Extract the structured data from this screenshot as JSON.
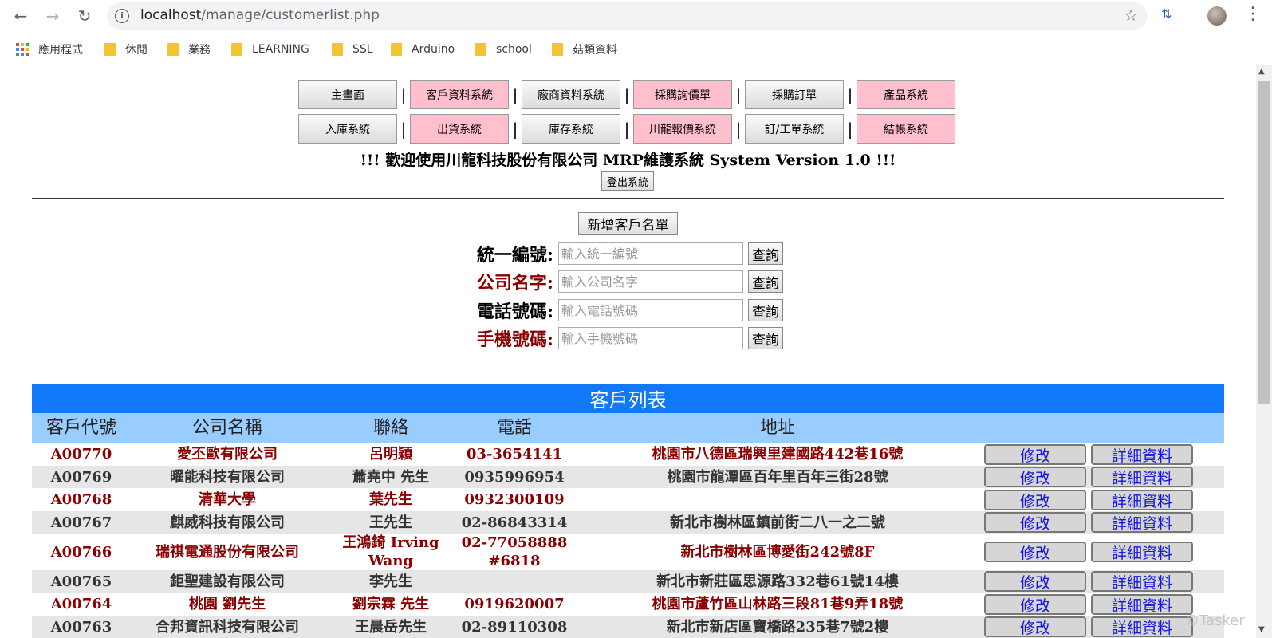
{
  "browser": {
    "url_host": "localhost",
    "url_path": "/manage/customerlist.php",
    "bookmarks": [
      "應用程式",
      "休閒",
      "業務",
      "LEARNING",
      "SSL",
      "Arduino",
      "school",
      "菇類資料"
    ]
  },
  "nav": {
    "row1": [
      {
        "label": "主畫面",
        "style": "gray"
      },
      {
        "label": "客戶資料系統",
        "style": "pink"
      },
      {
        "label": "廠商資料系統",
        "style": "gray"
      },
      {
        "label": "採購詢價單",
        "style": "pink"
      },
      {
        "label": "採購訂單",
        "style": "gray"
      },
      {
        "label": "產品系統",
        "style": "pink"
      }
    ],
    "row2": [
      {
        "label": "入庫系統",
        "style": "gray"
      },
      {
        "label": "出貨系統",
        "style": "pink"
      },
      {
        "label": "庫存系統",
        "style": "gray"
      },
      {
        "label": "川龍報價系統",
        "style": "pink"
      },
      {
        "label": "訂/工單系統",
        "style": "gray"
      },
      {
        "label": "結帳系統",
        "style": "pink"
      }
    ],
    "separator": "|"
  },
  "welcome": "!!! 歡迎使用川龍科技股份有限公司 MRP維護系統 System Version 1.0 !!!",
  "logout_label": "登出系統",
  "add_customer_label": "新增客戶名單",
  "search": [
    {
      "label": "統一編號:",
      "placeholder": "輸入統一編號",
      "button": "查詢",
      "color": "#000000"
    },
    {
      "label": "公司名字:",
      "placeholder": "輸入公司名字",
      "button": "查詢",
      "color": "#8b0000"
    },
    {
      "label": "電話號碼:",
      "placeholder": "輸入電話號碼",
      "button": "查詢",
      "color": "#000000"
    },
    {
      "label": "手機號碼:",
      "placeholder": "輸入手機號碼",
      "button": "查詢",
      "color": "#8b0000"
    }
  ],
  "customer_list": {
    "title": "客戶列表",
    "headers": [
      "客戶代號",
      "公司名稱",
      "聯絡",
      "電話",
      "地址"
    ],
    "edit_label": "修改",
    "detail_label": "詳細資料",
    "rows": [
      {
        "id": "A00770",
        "company": "愛丕歐有限公司",
        "contact": "呂明穎",
        "phone": "03-3654141",
        "address": "桃園市八德區瑞興里建國路442巷16號"
      },
      {
        "id": "A00769",
        "company": "曜能科技有限公司",
        "contact": "蕭堯中 先生",
        "phone": "0935996954",
        "address": "桃園市龍潭區百年里百年三街28號"
      },
      {
        "id": "A00768",
        "company": "清華大學",
        "contact": "葉先生",
        "phone": "0932300109",
        "address": ""
      },
      {
        "id": "A00767",
        "company": "麒威科技有限公司",
        "contact": "王先生",
        "phone": "02-86843314",
        "address": "新北市樹林區鎮前街二八一之二號"
      },
      {
        "id": "A00766",
        "company": "瑞祺電通股份有限公司",
        "contact": "王鴻錡 Irving Wang",
        "phone": "02-77058888 #6818",
        "address": "新北市樹林區博愛街242號8F"
      },
      {
        "id": "A00765",
        "company": "鉅聖建設有限公司",
        "contact": "李先生",
        "phone": "",
        "address": "新北市新莊區思源路332巷61號14樓"
      },
      {
        "id": "A00764",
        "company": "桃園 劉先生",
        "contact": "劉宗霖 先生",
        "phone": "0919620007",
        "address": "桃園市蘆竹區山林路三段81巷9弄18號"
      },
      {
        "id": "A00763",
        "company": "合邦資訊科技有限公司",
        "contact": "王晨岳先生",
        "phone": "02-89110308",
        "address": "新北市新店區寶橋路235巷7號2樓"
      }
    ]
  },
  "watermark": "©Tasker"
}
